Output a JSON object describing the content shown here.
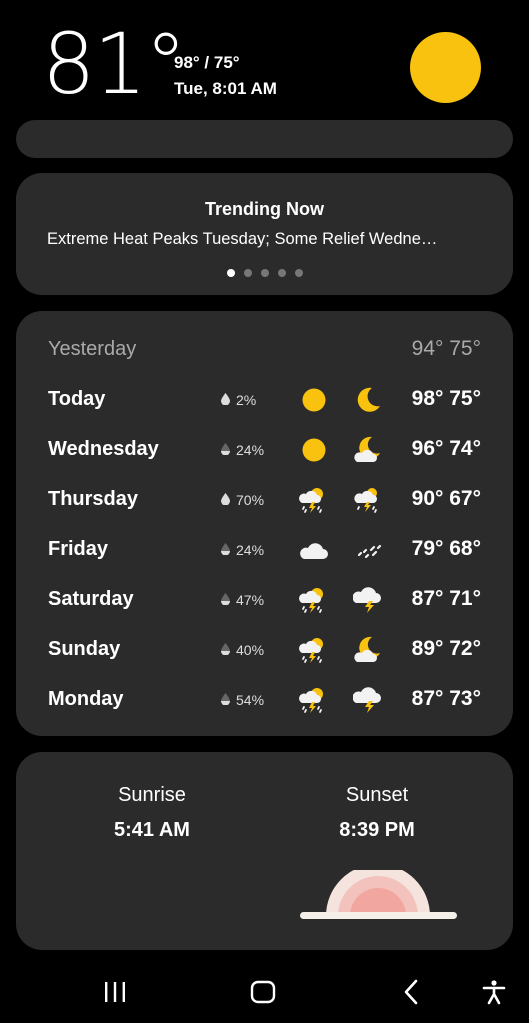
{
  "current": {
    "temperature": "81°",
    "hi_lo": "98° / 75°",
    "date_time": "Tue, 8:01 AM",
    "condition_icon": "sun-icon"
  },
  "trending": {
    "title": "Trending Now",
    "headline": "Extreme Heat Peaks Tuesday; Some Relief Wedne…",
    "page_count": 5,
    "active_page": 1
  },
  "forecast": {
    "yesterday": {
      "day": "Yesterday",
      "hi_lo": "94° 75°"
    },
    "days": [
      {
        "day": "Today",
        "precip": "2%",
        "day_icon": "sun-icon",
        "night_icon": "moon-icon",
        "hi_lo": "98° 75°"
      },
      {
        "day": "Wednesday",
        "precip": "24%",
        "day_icon": "sun-icon",
        "night_icon": "moon-cloud-icon",
        "hi_lo": "96° 74°"
      },
      {
        "day": "Thursday",
        "precip": "70%",
        "day_icon": "thunderstorm-sun-icon",
        "night_icon": "thunderstorm-icon",
        "hi_lo": "90° 67°"
      },
      {
        "day": "Friday",
        "precip": "24%",
        "day_icon": "cloud-icon",
        "night_icon": "drizzle-icon",
        "hi_lo": "79° 68°"
      },
      {
        "day": "Saturday",
        "precip": "47%",
        "day_icon": "thunderstorm-sun-icon",
        "night_icon": "lightning-cloud-icon",
        "hi_lo": "87° 71°"
      },
      {
        "day": "Sunday",
        "precip": "40%",
        "day_icon": "thunderstorm-sun-icon",
        "night_icon": "moon-cloud-icon",
        "hi_lo": "89° 72°"
      },
      {
        "day": "Monday",
        "precip": "54%",
        "day_icon": "thunderstorm-sun-icon",
        "night_icon": "lightning-cloud-icon",
        "hi_lo": "87° 73°"
      }
    ]
  },
  "sun": {
    "sunrise_label": "Sunrise",
    "sunrise_time": "5:41 AM",
    "sunset_label": "Sunset",
    "sunset_time": "8:39 PM"
  },
  "colors": {
    "sun": "#f8c20e",
    "card": "#2b2b2b",
    "sunset_arc": "#f2a6a0"
  },
  "navbar": {
    "buttons": [
      "recent-apps-icon",
      "home-icon",
      "back-icon",
      "accessibility-icon"
    ]
  }
}
